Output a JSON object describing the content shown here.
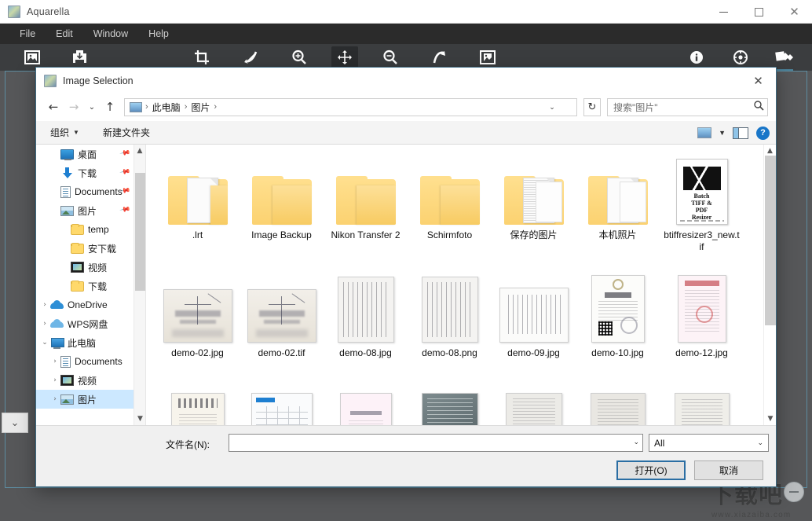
{
  "app": {
    "title": "Aquarella",
    "icon": "aquarella-app-icon",
    "window_buttons": [
      {
        "name": "minimize",
        "glyph": "minimize-icon"
      },
      {
        "name": "maximize",
        "glyph": "maximize-icon"
      },
      {
        "name": "close",
        "glyph": "close-icon"
      }
    ],
    "menu": [
      "File",
      "Edit",
      "Window",
      "Help"
    ],
    "toolbar": [
      {
        "name": "open-image-icon",
        "title": "Open image"
      },
      {
        "name": "save-image-icon",
        "title": "Save image"
      },
      {
        "name": "crop-icon",
        "title": "Crop"
      },
      {
        "name": "curve-icon",
        "title": "Curve"
      },
      {
        "name": "zoom-in-icon",
        "title": "Zoom in"
      },
      {
        "name": "pan-move-icon",
        "title": "Pan",
        "active": true
      },
      {
        "name": "zoom-out-icon",
        "title": "Zoom out"
      },
      {
        "name": "redo-arrow-icon",
        "title": "Rotate"
      },
      {
        "name": "image-frame-icon",
        "title": "Fit image"
      },
      {
        "name": "info-icon",
        "title": "Info"
      },
      {
        "name": "settings-icon",
        "title": "Settings"
      },
      {
        "name": "effects-icon",
        "title": "Effects"
      }
    ],
    "zoom_minus_label": "−"
  },
  "watermark": {
    "main": "下载吧",
    "sub": "www.xiazaiba.com"
  },
  "dialog": {
    "title": "Image Selection",
    "close_label": "✕",
    "nav": {
      "back": "←",
      "forward": "→",
      "recent": "⌄",
      "up": "↑",
      "breadcrumb": [
        "此电脑",
        "图片"
      ],
      "breadcrumb_sep": "›",
      "refresh": "↻",
      "search_placeholder": "搜索\"图片\"",
      "search_icon": "search-icon"
    },
    "commands": {
      "organize": "组织",
      "organize_caret": "▼",
      "new_folder": "新建文件夹",
      "view_caret": "▼",
      "help": "?"
    },
    "sidebar": [
      {
        "label": "桌面",
        "icon": "monitor-icon",
        "indent": 1,
        "twisty": "",
        "pinned": true
      },
      {
        "label": "下载",
        "icon": "download-arrow-icon",
        "indent": 1,
        "twisty": "",
        "pinned": true
      },
      {
        "label": "Documents",
        "icon": "documents-icon",
        "indent": 1,
        "twisty": "",
        "pinned": true
      },
      {
        "label": "图片",
        "icon": "pictures-icon",
        "indent": 1,
        "twisty": "",
        "pinned": true
      },
      {
        "label": "temp",
        "icon": "folder-icon",
        "indent": 2,
        "twisty": "",
        "pinned": false
      },
      {
        "label": "安下载",
        "icon": "folder-icon",
        "indent": 2,
        "twisty": "",
        "pinned": false
      },
      {
        "label": "视频",
        "icon": "video-icon",
        "indent": 2,
        "twisty": "",
        "pinned": false
      },
      {
        "label": "下载",
        "icon": "folder-icon",
        "indent": 2,
        "twisty": "",
        "pinned": false
      },
      {
        "label": "OneDrive",
        "icon": "onedrive-cloud-icon",
        "indent": 0,
        "twisty": "›",
        "pinned": false
      },
      {
        "label": "WPS网盘",
        "icon": "wps-cloud-icon",
        "indent": 0,
        "twisty": "›",
        "pinned": false
      },
      {
        "label": "此电脑",
        "icon": "this-pc-icon",
        "indent": 0,
        "twisty": "⌄",
        "pinned": false
      },
      {
        "label": "Documents",
        "icon": "documents-icon",
        "indent": 1,
        "twisty": "›",
        "pinned": false
      },
      {
        "label": "视频",
        "icon": "video-icon",
        "indent": 1,
        "twisty": "›",
        "pinned": false
      },
      {
        "label": "图片",
        "icon": "pictures-icon",
        "indent": 1,
        "twisty": "›",
        "pinned": false,
        "selected": true
      }
    ],
    "files": [
      {
        "name": ".lrt",
        "kind": "folder-doc"
      },
      {
        "name": "Image Backup",
        "kind": "folder"
      },
      {
        "name": "Nikon Transfer 2",
        "kind": "folder"
      },
      {
        "name": "Schirmfoto",
        "kind": "folder"
      },
      {
        "name": "保存的图片",
        "kind": "folder-lined"
      },
      {
        "name": "本机照片",
        "kind": "folder-papers"
      },
      {
        "name": "btiffresizer3_new.tif",
        "kind": "tif-cover",
        "cover_lines": [
          "Batch",
          "TIFF &",
          "PDF",
          "Resizer"
        ]
      },
      {
        "name": "demo-02.jpg",
        "kind": "photo-drawing"
      },
      {
        "name": "demo-02.tif",
        "kind": "photo-drawing"
      },
      {
        "name": "demo-08.jpg",
        "kind": "photo-text"
      },
      {
        "name": "demo-08.png",
        "kind": "photo-text"
      },
      {
        "name": "demo-09.jpg",
        "kind": "photo-doc"
      },
      {
        "name": "demo-10.jpg",
        "kind": "photo-license"
      },
      {
        "name": "demo-12.jpg",
        "kind": "photo-pink"
      },
      {
        "name": "",
        "kind": "photo-row3-a"
      },
      {
        "name": "",
        "kind": "photo-row3-b"
      },
      {
        "name": "",
        "kind": "photo-row3-c"
      },
      {
        "name": "",
        "kind": "photo-row3-d"
      },
      {
        "name": "",
        "kind": "photo-row3-e"
      },
      {
        "name": "",
        "kind": "photo-row3-f"
      },
      {
        "name": "",
        "kind": "photo-row3-g"
      }
    ],
    "footer": {
      "filename_label": "文件名(N):",
      "filename_value": "",
      "filename_caret": "⌄",
      "filetype_value": "All",
      "filetype_caret": "⌄",
      "open_button": "打开(O)",
      "cancel_button": "取消"
    }
  },
  "colors": {
    "accent": "#2b6ea3",
    "selection": "#cce8ff",
    "folder": "#fbd271",
    "app_chrome": "#3b3d3f",
    "menu_bar": "#2b2b2b",
    "canvas": "#565759"
  }
}
